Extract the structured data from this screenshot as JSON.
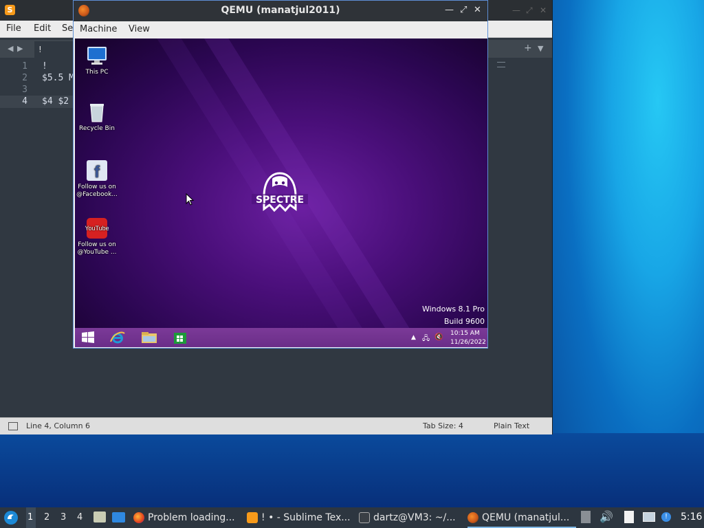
{
  "sublime": {
    "menu": [
      "File",
      "Edit",
      "Se"
    ],
    "tab_label": "!",
    "lines": [
      {
        "num": "1",
        "text": "!"
      },
      {
        "num": "2",
        "text": "$5.5 M"
      },
      {
        "num": "3",
        "text": ""
      },
      {
        "num": "4",
        "text": "$4 $2"
      }
    ],
    "status": {
      "position": "Line 4, Column 6",
      "tab_size": "Tab Size: 4",
      "syntax": "Plain Text"
    }
  },
  "qemu": {
    "title": "QEMU (manatjul2011)",
    "menu": [
      "Machine",
      "View"
    ],
    "desktop_icons": [
      {
        "label": "This PC",
        "icon": "computer-icon"
      },
      {
        "label": "Recycle Bin",
        "icon": "recycle-bin-icon"
      },
      {
        "label": "Follow us on @Facebook...",
        "icon": "facebook-icon"
      },
      {
        "label": "Follow us on @YouTube ...",
        "icon": "youtube-icon"
      }
    ],
    "logo_text": "SPECTRE",
    "edition": "Windows 8.1 Pro",
    "build": "Build 9600",
    "clock_time": "10:15 AM",
    "clock_date": "11/26/2022"
  },
  "panel": {
    "workspaces": [
      "1",
      "2",
      "3",
      "4"
    ],
    "tasks": [
      {
        "label": "Problem loading...",
        "icon": "firefox-icon"
      },
      {
        "label": "! • - Sublime Tex...",
        "icon": "sublime-icon"
      },
      {
        "label": "dartz@VM3: ~/...",
        "icon": "terminal-icon"
      },
      {
        "label": "QEMU (manatjul...",
        "icon": "qemu-icon"
      }
    ],
    "clock": "5:16"
  },
  "colors": {
    "sublime_bg": "#303841",
    "qemu_border": "#5e8fd6",
    "win_taskbar": "#6a2d88"
  }
}
